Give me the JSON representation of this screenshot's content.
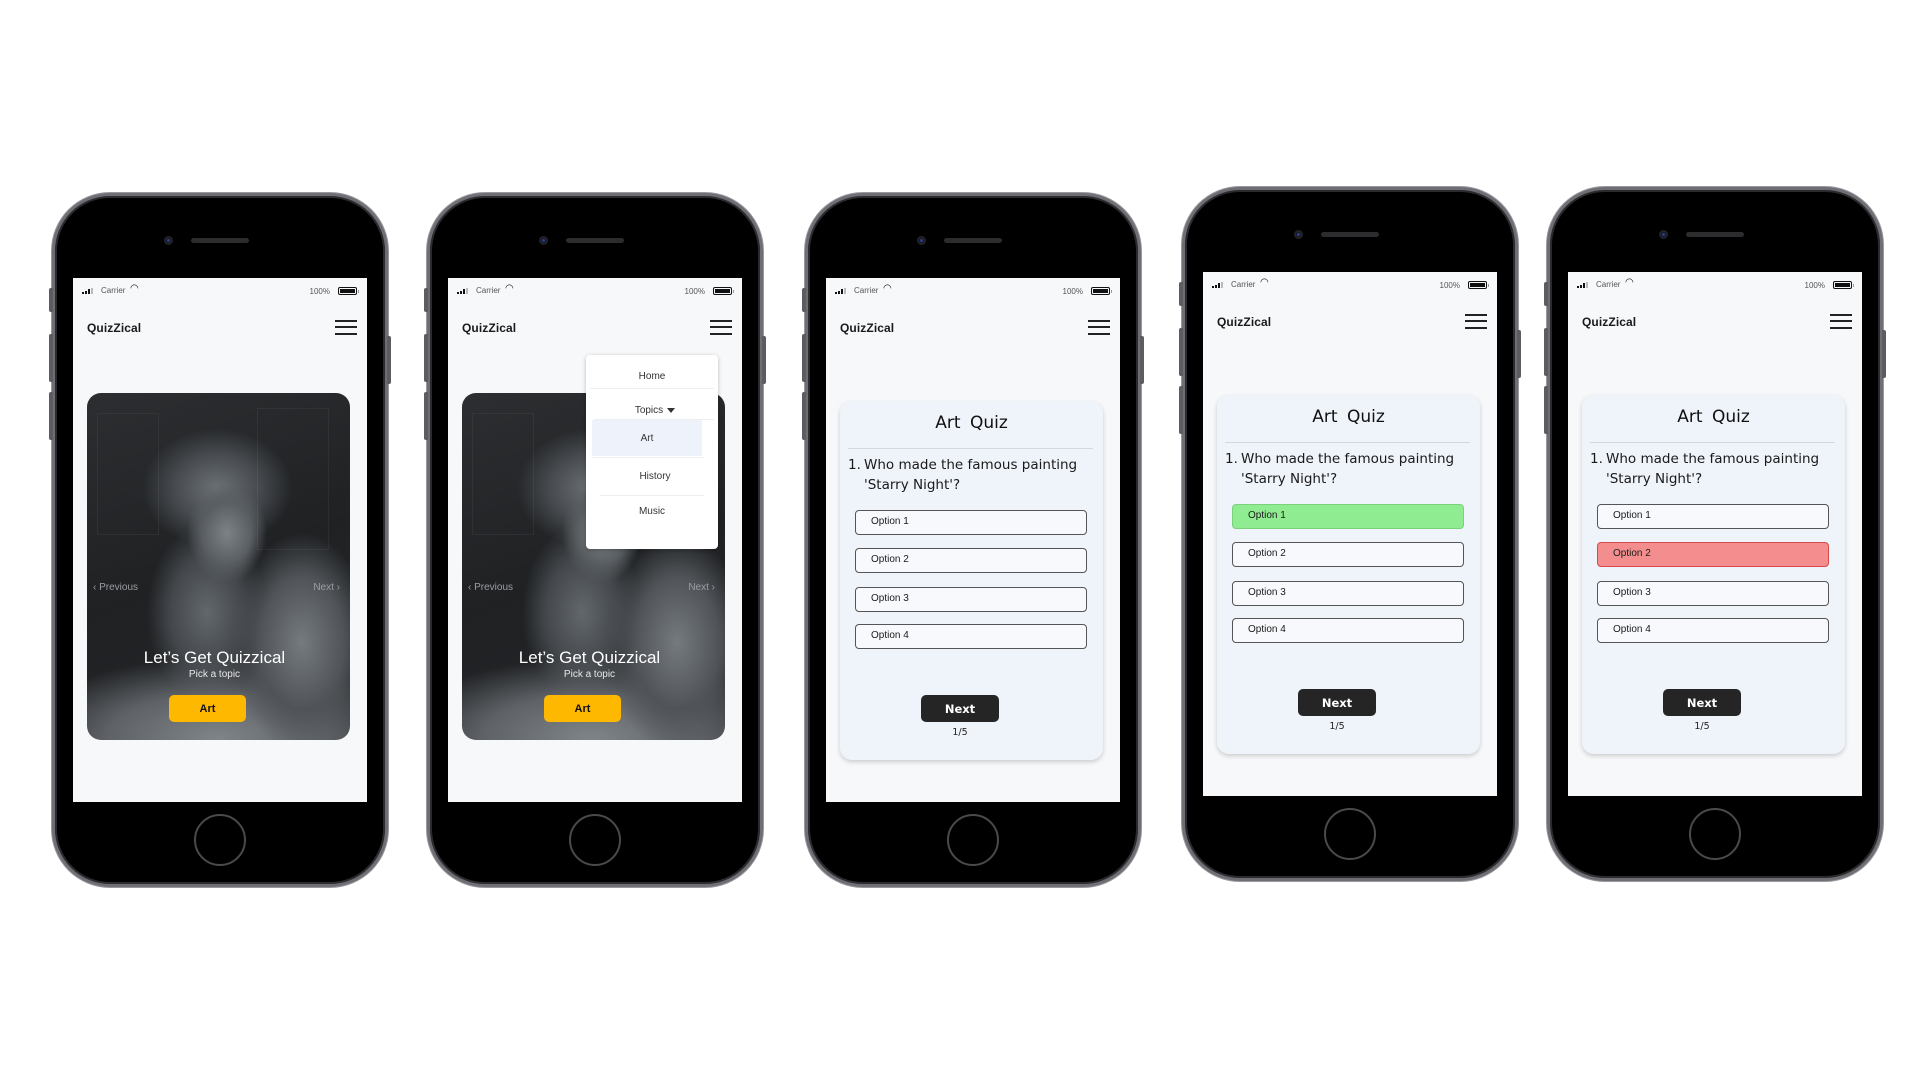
{
  "app": {
    "title": "QuizZical"
  },
  "status_bar": {
    "carrier": "Carrier",
    "battery": "100%"
  },
  "screens": [
    {
      "id": "home",
      "hero": {
        "prev_label": "Previous",
        "next_label": "Next",
        "heading": "Let’s Get Quizzical",
        "subheading": "Pick a topic",
        "topic_button": "Art"
      }
    },
    {
      "id": "home-menu-open",
      "hero": {
        "prev_label": "Previous",
        "next_label": "Next",
        "heading": "Let’s Get Quizzical",
        "subheading": "Pick a topic",
        "topic_button": "Art"
      },
      "menu": {
        "home": "Home",
        "topics": "Topics",
        "items": [
          "Art",
          "History",
          "Music"
        ],
        "highlighted": "Art"
      }
    },
    {
      "id": "quiz",
      "quiz": {
        "title": "Art Quiz",
        "question_number": "1.",
        "question": "Who made the famous painting 'Starry Night'?",
        "options": [
          "Option 1",
          "Option 2",
          "Option 3",
          "Option 4"
        ],
        "state": "unanswered",
        "next_label": "Next",
        "progress": "1/5"
      }
    },
    {
      "id": "quiz-correct",
      "quiz": {
        "title": "Art Quiz",
        "question_number": "1.",
        "question": "Who made the famous painting 'Starry Night'?",
        "options": [
          "Option 1",
          "Option 2",
          "Option 3",
          "Option 4"
        ],
        "state": "Option 1 correct",
        "next_label": "Next",
        "progress": "1/5"
      }
    },
    {
      "id": "quiz-wrong",
      "quiz": {
        "title": "Art Quiz",
        "question_number": "1.",
        "question": "Who made the famous painting 'Starry Night'?",
        "options": [
          "Option 1",
          "Option 2",
          "Option 3",
          "Option 4"
        ],
        "state": "Option 2 wrong",
        "next_label": "Next",
        "progress": "1/5"
      }
    }
  ],
  "colors": {
    "accent_button": "#ffb800",
    "correct": "#90ec90",
    "wrong": "#f48e8e",
    "next_button": "#252525",
    "card_bg": "#eff3fa"
  }
}
